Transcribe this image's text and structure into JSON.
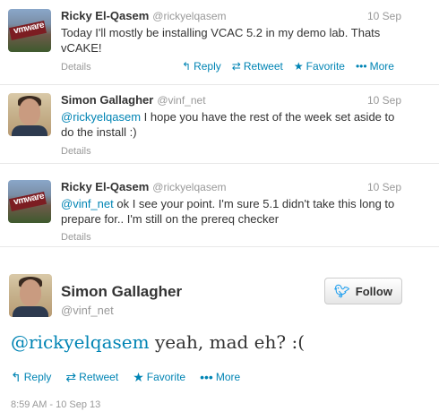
{
  "tweets": [
    {
      "name": "Ricky El-Qasem",
      "handle": "@rickyelqasem",
      "date": "10 Sep",
      "text": "Today I'll mostly be installing VCAC 5.2 in my demo lab. Thats vCAKE!",
      "details": "Details",
      "avatar": "vmware-logo-avatar"
    },
    {
      "name": "Simon Gallagher",
      "handle": "@vinf_net",
      "date": "10 Sep",
      "mention": "@rickyelqasem",
      "text": " I hope you have the rest of the week set aside to do the install :)",
      "details": "Details",
      "avatar": "person-avatar"
    },
    {
      "name": "Ricky El-Qasem",
      "handle": "@rickyelqasem",
      "date": "10 Sep",
      "mention": "@vinf_net",
      "text": " ok I see your point. I'm sure 5.1 didn't take this long to prepare for.. I'm still on the prereq checker",
      "details": "Details",
      "avatar": "vmware-logo-avatar"
    }
  ],
  "actions": {
    "reply": "Reply",
    "retweet": "Retweet",
    "favorite": "Favorite",
    "more": "More"
  },
  "expanded": {
    "name": "Simon Gallagher",
    "handle": "@vinf_net",
    "follow_label": "Follow",
    "mention": "@rickyelqasem",
    "text": " yeah, mad eh? :(",
    "timestamp": "8:59 AM - 10 Sep 13"
  },
  "avatar_logo_text": "vmware",
  "colors": {
    "link": "#0084b4",
    "muted": "#999999",
    "text": "#333333",
    "follow_bird": "#2aa3ef"
  }
}
